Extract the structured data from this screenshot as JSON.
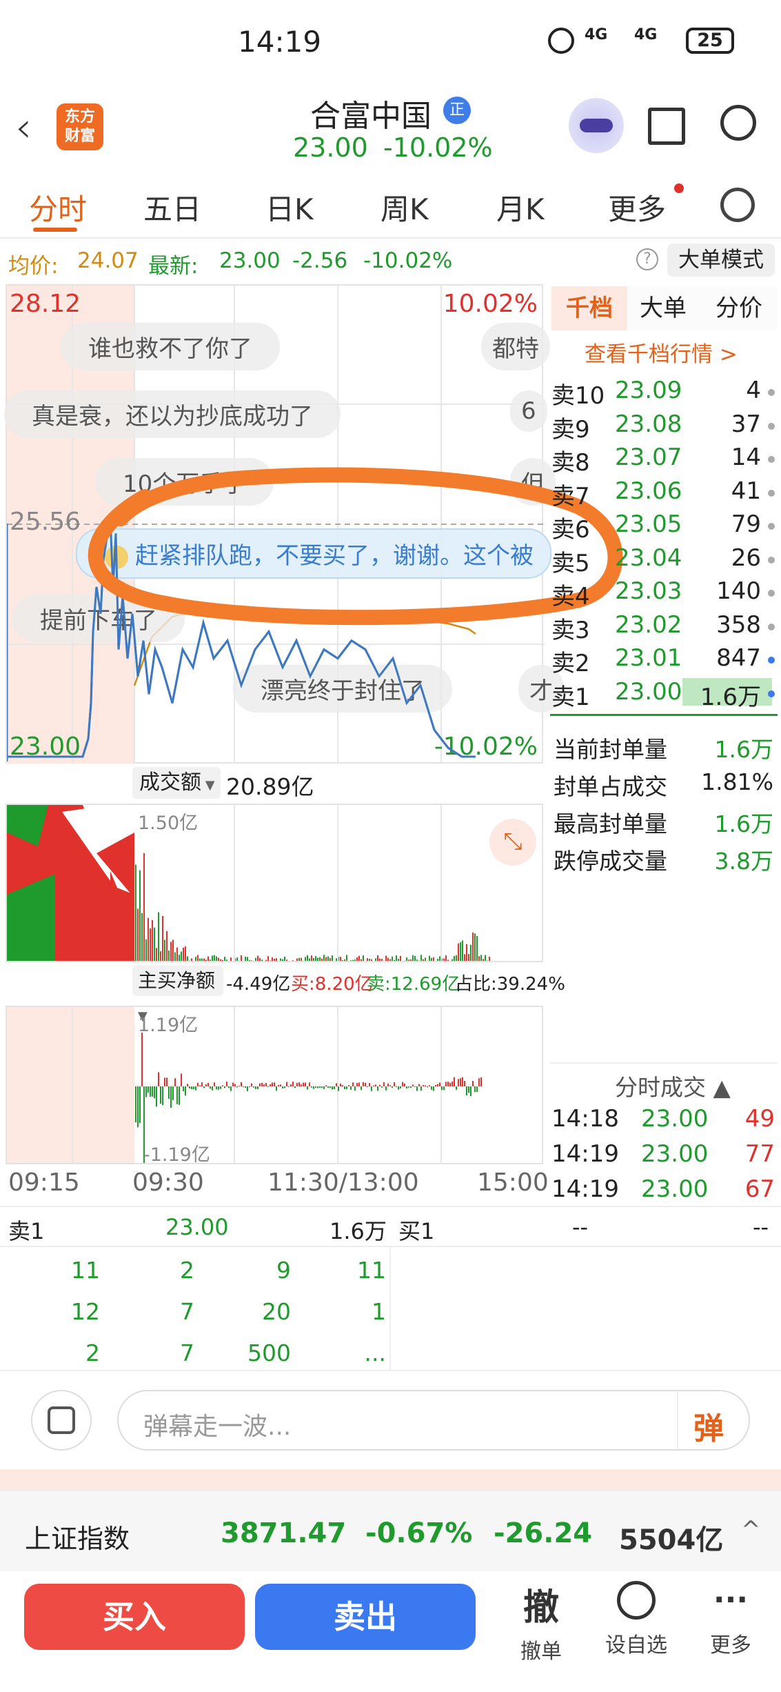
{
  "status": {
    "time": "14:19",
    "net1": "4G",
    "net2": "4G",
    "battery": "25"
  },
  "header": {
    "brand_line1": "东方",
    "brand_line2": "财富",
    "title": "合富中国",
    "badge": "正",
    "price": "23.00",
    "change_pct": "-10.02%"
  },
  "tabs": [
    {
      "label": "分时"
    },
    {
      "label": "五日"
    },
    {
      "label": "日K"
    },
    {
      "label": "周K"
    },
    {
      "label": "月K"
    },
    {
      "label": "更多"
    }
  ],
  "infobar": {
    "avg_label": "均价:",
    "avg_value": "24.07",
    "latest_label": "最新:",
    "latest_value": "23.00",
    "change": "-2.56",
    "change_pct": "-10.02%",
    "help": "?",
    "mode_button": "大单模式"
  },
  "chart": {
    "high_label": "28.12",
    "high_pct": "10.02%",
    "mid_label": "25.56",
    "low_label": "23.00",
    "low_pct": "-10.02%",
    "vol_selector": "成交额",
    "vol_total": "20.89亿",
    "vol_max": "1.50亿",
    "net_selector": "主买净额",
    "net_value": "-4.49亿",
    "net_buy": "买:8.20亿",
    "net_sell": "卖:12.69亿",
    "net_ratio": "占比:39.24%",
    "net_max": "1.19亿",
    "net_min": "-1.19亿",
    "x_labels": [
      "09:15",
      "09:30",
      "11:30/13:00",
      "15:00"
    ]
  },
  "chart_data": {
    "type": "line",
    "title": "",
    "x": [
      "09:15",
      "09:30",
      "11:30/13:00",
      "15:00"
    ],
    "ylim": [
      23.0,
      28.12
    ],
    "series": [
      {
        "name": "",
        "values": [
          23.0,
          23.0,
          25.66,
          25.0,
          24.6,
          24.3,
          24.8,
          24.2,
          23.7,
          23.0
        ]
      }
    ]
  },
  "danmaku": [
    "谁也救不了你了",
    "都特",
    "真是衰，还以为抄底成功了",
    "6",
    "10个万手了",
    "但",
    "赶紧排队跑，不要买了，谢谢。这个被",
    "提前下车了",
    "漂亮终于封住了",
    "才"
  ],
  "orderbook": {
    "tabs": [
      "千档",
      "大单",
      "分价"
    ],
    "view_link": "查看千档行情 >",
    "rows": [
      {
        "label": "卖10",
        "price": "23.09",
        "vol": "4"
      },
      {
        "label": "卖9",
        "price": "23.08",
        "vol": "37"
      },
      {
        "label": "卖8",
        "price": "23.07",
        "vol": "14"
      },
      {
        "label": "卖7",
        "price": "23.06",
        "vol": "41"
      },
      {
        "label": "卖6",
        "price": "23.05",
        "vol": "79"
      },
      {
        "label": "卖5",
        "price": "23.04",
        "vol": "26"
      },
      {
        "label": "卖4",
        "price": "23.03",
        "vol": "140"
      },
      {
        "label": "卖3",
        "price": "23.02",
        "vol": "358"
      },
      {
        "label": "卖2",
        "price": "23.01",
        "vol": "847"
      },
      {
        "label": "卖1",
        "price": "23.00",
        "vol": "1.6万"
      }
    ]
  },
  "seal_info": [
    {
      "label": "当前封单量",
      "value": "1.6万"
    },
    {
      "label": "封单占成交",
      "value": "1.81%"
    },
    {
      "label": "最高封单量",
      "value": "1.6万"
    },
    {
      "label": "跌停成交量",
      "value": "3.8万"
    }
  ],
  "trades": {
    "title": "分时成交",
    "rows": [
      {
        "time": "14:18",
        "price": "23.00",
        "vol": "49"
      },
      {
        "time": "14:19",
        "price": "23.00",
        "vol": "77"
      },
      {
        "time": "14:19",
        "price": "23.00",
        "vol": "67"
      }
    ]
  },
  "queue": {
    "left_label": "卖1",
    "left_price": "23.00",
    "left_total": "1.6万",
    "right_label": "买1",
    "right_price": "--",
    "right_total": "--",
    "cells": [
      "11",
      "2",
      "9",
      "11",
      "12",
      "7",
      "20",
      "1",
      "2",
      "7",
      "500",
      "..."
    ]
  },
  "comment": {
    "placeholder": "弹幕走一波...",
    "send": "弹"
  },
  "index": {
    "name": "上证指数",
    "value": "3871.47",
    "pct": "-0.67%",
    "change": "-26.24",
    "amount": "5504亿"
  },
  "bottom": {
    "buy": "买入",
    "sell": "卖出",
    "cancel_glyph": "撤",
    "cancel": "撤单",
    "watch": "设自选",
    "more": "更多"
  },
  "colors": {
    "accent": "#e2621b",
    "down": "#1f9a2c",
    "up": "#e0312c",
    "buy_btn": "#ee4b45",
    "sell_btn": "#3b79f0",
    "annotation": "#f37b2c"
  }
}
